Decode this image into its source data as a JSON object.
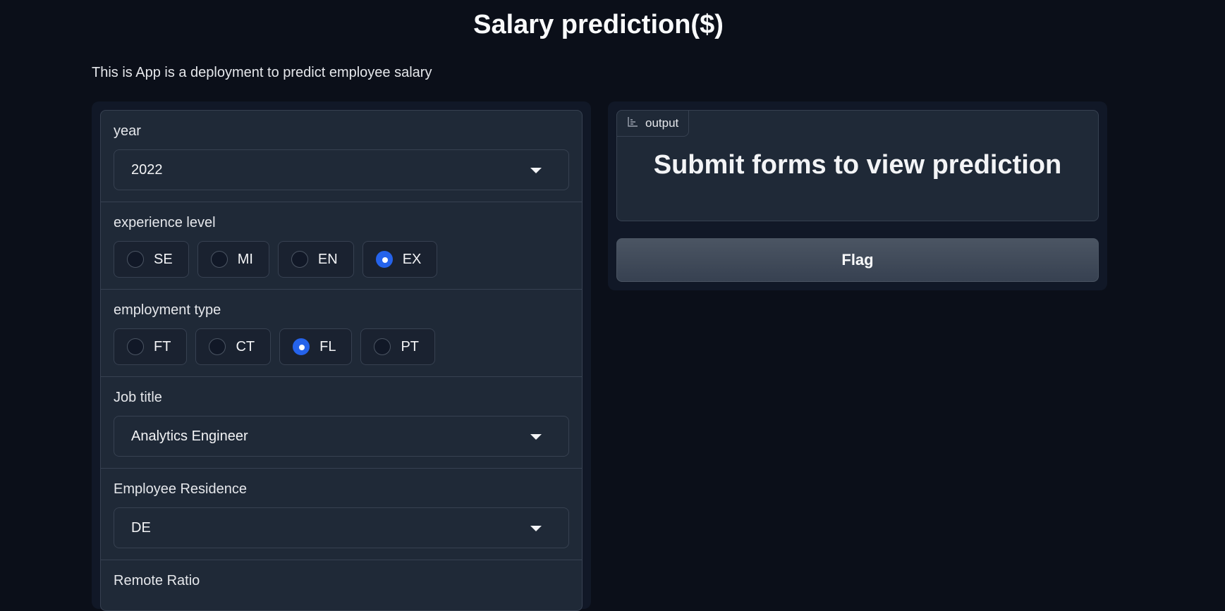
{
  "header": {
    "title": "Salary prediction($)",
    "description": "This is App is a deployment to predict employee salary"
  },
  "form": {
    "year": {
      "label": "year",
      "value": "2022"
    },
    "experience_level": {
      "label": "experience level",
      "options": [
        "SE",
        "MI",
        "EN",
        "EX"
      ],
      "selected": "EX"
    },
    "employment_type": {
      "label": "employment type",
      "options": [
        "FT",
        "CT",
        "FL",
        "PT"
      ],
      "selected": "FL"
    },
    "job_title": {
      "label": "Job title",
      "value": "Analytics Engineer"
    },
    "employee_residence": {
      "label": "Employee Residence",
      "value": "DE"
    },
    "remote_ratio": {
      "label": "Remote Ratio"
    }
  },
  "output": {
    "tag_label": "output",
    "tag_icon": "bar-chart-icon",
    "text": "Submit forms to view prediction",
    "flag_label": "Flag"
  },
  "colors": {
    "background": "#0b0f19",
    "panel": "#111827",
    "block": "#1f2937",
    "accent": "#2563eb"
  }
}
